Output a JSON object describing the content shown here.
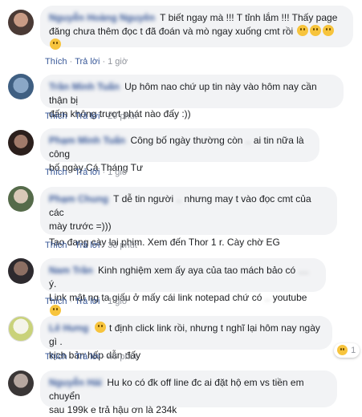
{
  "comments": [
    {
      "author": "Nguyễn Hoàng Nguyên",
      "text1": "T biết ngay mà !!! T tỉnh lắm !!! Thấy page",
      "text2": "đăng chưa thêm đọc t đã đoán và mò ngay xuống cmt rồi",
      "like": "Thích",
      "reply": "Trả lời",
      "time": "1 giờ"
    },
    {
      "author": "Trần Minh Tuấn",
      "text1": "Up hôm nao chứ up tin này vào hôm nay cần thận bị",
      "text2": "đấm không trượt phát nào đấy :))",
      "like": "Thích",
      "reply": "Trả lời",
      "time": "29 phút"
    },
    {
      "author": "Phạm Minh Tuấn",
      "text1": "Công bố ngày thường còn",
      "text1b": "ai tin nữa là công",
      "text2": "bố ngày Cá Tháng Tư",
      "like": "Thích",
      "reply": "Trả lời",
      "time": "1 giờ"
    },
    {
      "author": "Phạm Chung",
      "text1": "T dễ tin người",
      "text1b": "nhưng may t vào đọc cmt của các",
      "text2": "mày trước =)))",
      "text3": "Tao đang cày lại phim. Xem đến Thor 1 r. Cày chờ EG",
      "like": "Thích",
      "reply": "Trả lời",
      "time": "33 phút"
    },
    {
      "author": "Nam Trần",
      "text1": "Kinh nghiệm xem ấy aya của tao mách bảo có",
      "text1b": "ý.",
      "text2": "Link mật ng ta giấu ở mấy cái link notepad chứ có",
      "text2b": "youtube",
      "like": "Thích",
      "reply": "Trả lời",
      "time": "1 giờ"
    },
    {
      "author": "Lê Hưng",
      "text1": "t định click link rồi, nhưng t nghĩ lại hôm nay ngày gì .",
      "text2": "kịch bản hấp dẫn đấy",
      "like": "Thích",
      "reply": "Trả lời",
      "time": "46 phút",
      "reaction_count": "1"
    },
    {
      "author": "Nguyễn Hải",
      "text1": "Hu ko có đk off line đc ai đặt hộ em vs tiền em chuyển",
      "text2": "sau 199k e trả hậu ơn là 234k"
    }
  ],
  "colors": {
    "link": "#385898",
    "bubble": "#f2f3f5",
    "meta": "#90949c",
    "emoji": "#f7c43d"
  },
  "icons": [
    "laughing-emoji-icon",
    "haha-reaction-icon",
    "avatar"
  ]
}
